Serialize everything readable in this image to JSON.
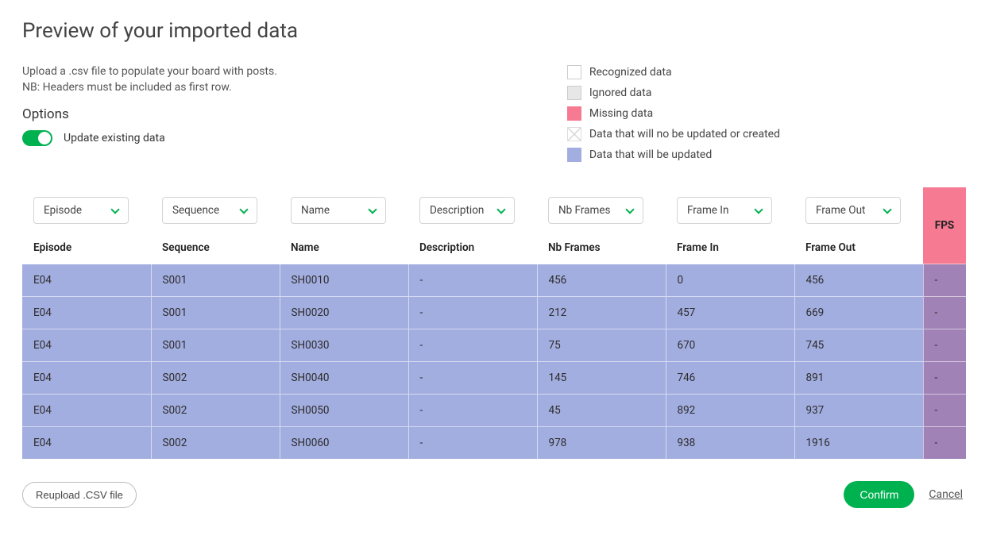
{
  "title": "Preview of your imported data",
  "instructions1": "Upload a .csv file to populate your board with posts.",
  "instructions2": "NB: Headers must be included as first row.",
  "optionsHeader": "Options",
  "updateExistingLabel": "Update existing data",
  "legend": {
    "recognized": "Recognized data",
    "ignored": "Ignored data",
    "missing": "Missing data",
    "noChange": "Data that will no be updated or created",
    "updated": "Data that will be updated"
  },
  "columns": [
    {
      "dropdown": "Episode",
      "header": "Episode"
    },
    {
      "dropdown": "Sequence",
      "header": "Sequence"
    },
    {
      "dropdown": "Name",
      "header": "Name"
    },
    {
      "dropdown": "Description",
      "header": "Description"
    },
    {
      "dropdown": "Nb Frames",
      "header": "Nb Frames"
    },
    {
      "dropdown": "Frame In",
      "header": "Frame In"
    },
    {
      "dropdown": "Frame Out",
      "header": "Frame Out"
    }
  ],
  "missingColumn": "FPS",
  "rows": [
    {
      "episode": "E04",
      "sequence": "S001",
      "name": "SH0010",
      "description": "-",
      "frames": "456",
      "in": "0",
      "out": "456",
      "fps": "-"
    },
    {
      "episode": "E04",
      "sequence": "S001",
      "name": "SH0020",
      "description": "-",
      "frames": "212",
      "in": "457",
      "out": "669",
      "fps": "-"
    },
    {
      "episode": "E04",
      "sequence": "S001",
      "name": "SH0030",
      "description": "-",
      "frames": "75",
      "in": "670",
      "out": "745",
      "fps": "-"
    },
    {
      "episode": "E04",
      "sequence": "S002",
      "name": "SH0040",
      "description": "-",
      "frames": "145",
      "in": "746",
      "out": "891",
      "fps": "-"
    },
    {
      "episode": "E04",
      "sequence": "S002",
      "name": "SH0050",
      "description": "-",
      "frames": "45",
      "in": "892",
      "out": "937",
      "fps": "-"
    },
    {
      "episode": "E04",
      "sequence": "S002",
      "name": "SH0060",
      "description": "-",
      "frames": "978",
      "in": "938",
      "out": "1916",
      "fps": "-"
    }
  ],
  "buttons": {
    "reupload": "Reupload .CSV file",
    "confirm": "Confirm",
    "cancel": "Cancel"
  }
}
